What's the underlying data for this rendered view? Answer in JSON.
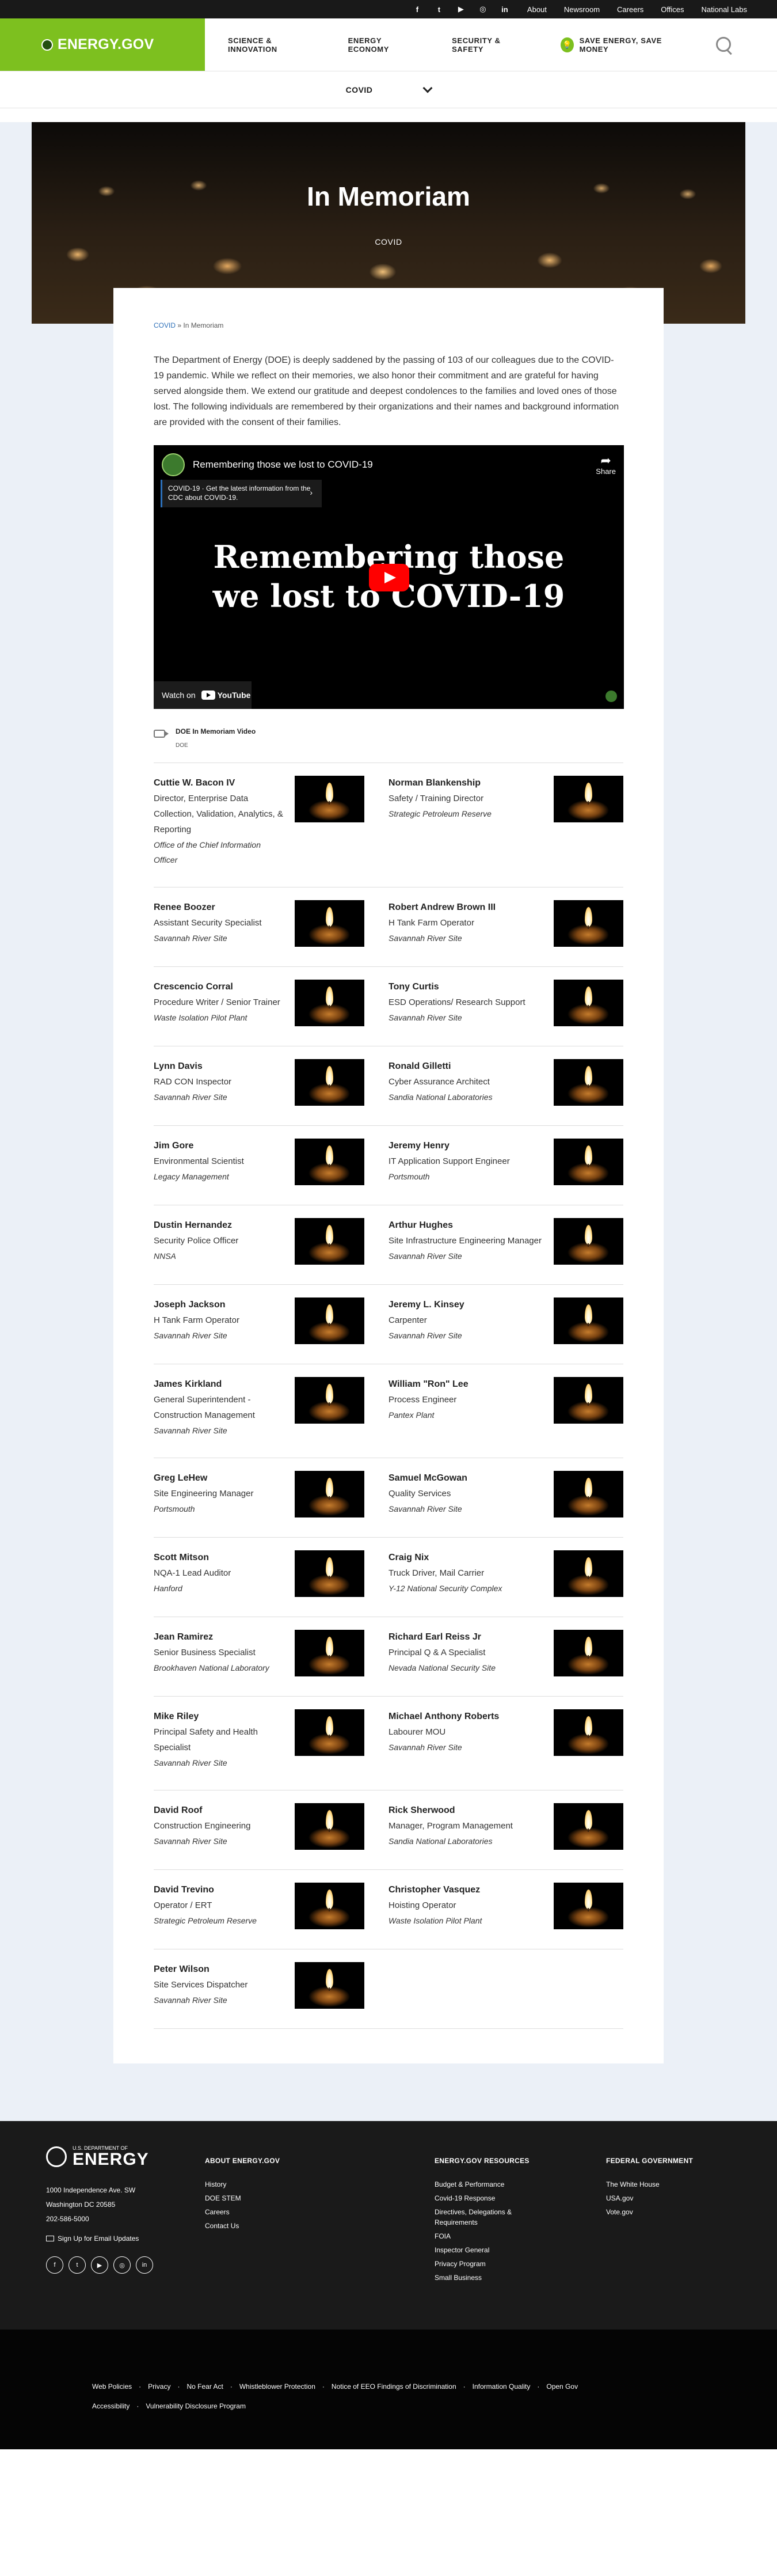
{
  "util": {
    "social_icons": [
      "facebook-icon",
      "twitter-icon",
      "youtube-icon",
      "instagram-icon",
      "linkedin-icon"
    ],
    "links": [
      "About",
      "Newsroom",
      "Careers",
      "Offices",
      "National Labs"
    ]
  },
  "header": {
    "logo": "ENERGY.GOV",
    "nav": [
      "SCIENCE & INNOVATION",
      "ENERGY ECONOMY",
      "SECURITY & SAFETY"
    ],
    "save": "SAVE ENERGY, SAVE MONEY"
  },
  "subnav": {
    "label": "COVID"
  },
  "hero": {
    "title": "In Memoriam",
    "subtitle": "COVID"
  },
  "breadcrumb": {
    "link": "COVID",
    "sep": "»",
    "current": "In Memoriam"
  },
  "intro": "The Department of Energy (DOE) is deeply saddened by the passing of 103 of our colleagues due to the COVID-19 pandemic. While we reflect on their memories, we also honor their commitment and are grateful for having served alongside them. We extend our gratitude and deepest condolences to the families and loved ones of those lost. The following individuals are remembered by their organizations and their names and background information are provided with the consent of their families.",
  "video": {
    "title": "Remembering those we lost to COVID-19",
    "share": "Share",
    "info": "COVID-19 · Get the latest information from the CDC about COVID-19.",
    "big_line1": "Remembering those",
    "big_line2": "we lost to COVID-19",
    "watch_on": "Watch on",
    "youtube": "YouTube"
  },
  "video_meta": {
    "title": "DOE In Memoriam Video",
    "tag": "DOE"
  },
  "people": [
    [
      {
        "name": "Cuttie W. Bacon IV",
        "title": "Director, Enterprise Data Collection, Validation, Analytics, & Reporting",
        "org": "Office of the Chief Information Officer"
      },
      {
        "name": "Norman Blankenship",
        "title": "Safety / Training Director",
        "org": "Strategic Petroleum Reserve"
      }
    ],
    [
      {
        "name": "Renee Boozer",
        "title": "Assistant Security Specialist",
        "org": "Savannah River Site"
      },
      {
        "name": "Robert Andrew Brown III",
        "title": "H Tank Farm Operator",
        "org": "Savannah River Site"
      }
    ],
    [
      {
        "name": "Crescencio Corral",
        "title": "Procedure Writer / Senior Trainer",
        "org": "Waste Isolation Pilot Plant"
      },
      {
        "name": "Tony Curtis",
        "title": "ESD Operations/ Research Support",
        "org": "Savannah River Site"
      }
    ],
    [
      {
        "name": "Lynn Davis",
        "title": "RAD CON Inspector",
        "org": "Savannah River Site"
      },
      {
        "name": "Ronald Gilletti",
        "title": "Cyber Assurance Architect",
        "org": "Sandia National Laboratories"
      }
    ],
    [
      {
        "name": "Jim Gore",
        "title": "Environmental Scientist",
        "org": "Legacy Management"
      },
      {
        "name": "Jeremy Henry",
        "title": "IT Application Support Engineer",
        "org": "Portsmouth"
      }
    ],
    [
      {
        "name": "Dustin Hernandez",
        "title": "Security Police Officer",
        "org": "NNSA"
      },
      {
        "name": "Arthur Hughes",
        "title": "Site Infrastructure Engineering Manager",
        "org": "Savannah River Site"
      }
    ],
    [
      {
        "name": "Joseph Jackson",
        "title": "H Tank Farm Operator",
        "org": "Savannah River Site"
      },
      {
        "name": "Jeremy L. Kinsey",
        "title": "Carpenter",
        "org": "Savannah River Site"
      }
    ],
    [
      {
        "name": "James Kirkland",
        "title": "General Superintendent - Construction Management",
        "org": "Savannah River Site"
      },
      {
        "name": "William \"Ron\" Lee",
        "title": "Process Engineer",
        "org": "Pantex Plant"
      }
    ],
    [
      {
        "name": "Greg LeHew",
        "title": "Site Engineering Manager",
        "org": "Portsmouth"
      },
      {
        "name": "Samuel McGowan",
        "title": "Quality Services",
        "org": "Savannah River Site"
      }
    ],
    [
      {
        "name": "Scott Mitson",
        "title": "NQA-1 Lead Auditor",
        "org": "Hanford"
      },
      {
        "name": "Craig Nix",
        "title": "Truck Driver, Mail Carrier",
        "org": "Y-12 National Security Complex"
      }
    ],
    [
      {
        "name": "Jean Ramirez",
        "title": "Senior Business Specialist",
        "org": "Brookhaven National Laboratory"
      },
      {
        "name": "Richard Earl Reiss Jr",
        "title": "Principal Q & A Specialist",
        "org": "Nevada National Security Site"
      }
    ],
    [
      {
        "name": "Mike Riley",
        "title": "Principal Safety and Health Specialist",
        "org": "Savannah River Site"
      },
      {
        "name": "Michael Anthony Roberts",
        "title": "Labourer MOU",
        "org": "Savannah River Site"
      }
    ],
    [
      {
        "name": "David Roof",
        "title": "Construction Engineering",
        "org": "Savannah River Site"
      },
      {
        "name": "Rick Sherwood",
        "title": "Manager, Program Management",
        "org": "Sandia National Laboratories"
      }
    ],
    [
      {
        "name": "David Trevino",
        "title": "Operator / ERT",
        "org": "Strategic Petroleum Reserve"
      },
      {
        "name": "Christopher Vasquez",
        "title": "Hoisting Operator",
        "org": "Waste Isolation Pilot Plant"
      }
    ],
    [
      {
        "name": "Peter Wilson",
        "title": "Site Services Dispatcher",
        "org": "Savannah River Site"
      }
    ]
  ],
  "footer": {
    "logo_small": "U.S. DEPARTMENT OF",
    "logo_big": "ENERGY",
    "address": [
      "1000 Independence Ave. SW",
      "Washington DC 20585",
      "202-586-5000"
    ],
    "signup": "Sign Up for Email Updates",
    "social_icons": [
      "facebook-icon",
      "twitter-icon",
      "youtube-icon",
      "instagram-icon",
      "linkedin-icon"
    ],
    "about": {
      "title": "ABOUT ENERGY.GOV",
      "links": [
        "History",
        "DOE STEM",
        "Careers",
        "Contact Us"
      ]
    },
    "resources": {
      "title": "ENERGY.GOV RESOURCES",
      "links": [
        "Budget & Performance",
        "Covid-19 Response",
        "Directives, Delegations & Requirements",
        "FOIA",
        "Inspector General",
        "Privacy Program",
        "Small Business"
      ]
    },
    "federal": {
      "title": "FEDERAL GOVERNMENT",
      "links": [
        "The White House",
        "USA.gov",
        "Vote.gov"
      ]
    }
  },
  "subfooter": [
    "Web Policies",
    "Privacy",
    "No Fear Act",
    "Whistleblower Protection",
    "Notice of EEO Findings of Discrimination",
    "Information Quality",
    "Open Gov",
    "Accessibility",
    "Vulnerability Disclosure Program"
  ]
}
